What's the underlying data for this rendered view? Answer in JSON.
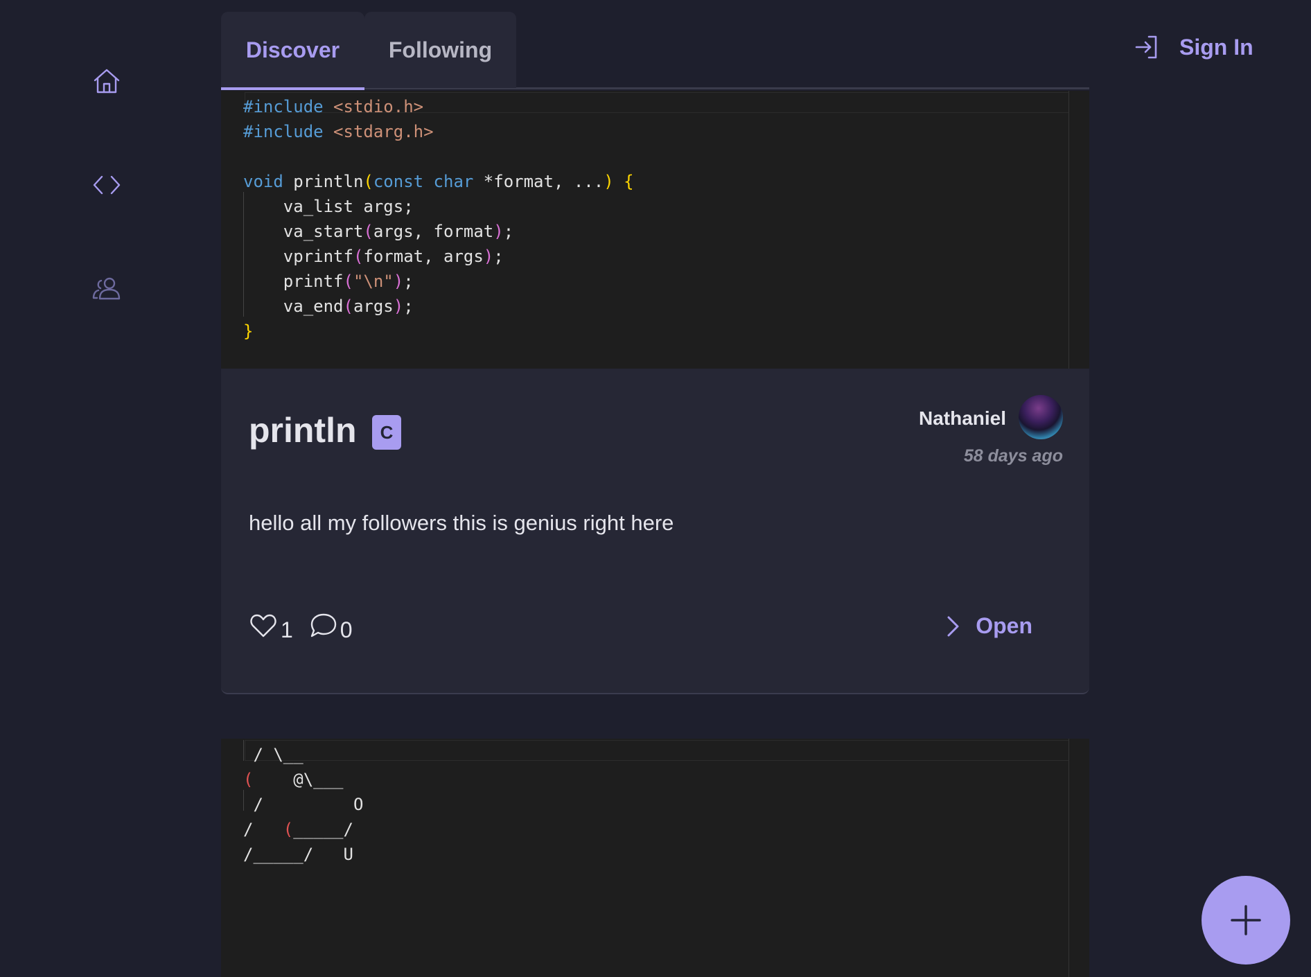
{
  "sidebar": {
    "items": [
      {
        "name": "home",
        "icon": "home-icon"
      },
      {
        "name": "code",
        "icon": "code-icon"
      },
      {
        "name": "users",
        "icon": "users-icon"
      }
    ]
  },
  "tabs": [
    {
      "label": "Discover",
      "active": true
    },
    {
      "label": "Following",
      "active": false
    }
  ],
  "header": {
    "sign_in_label": "Sign In",
    "sign_in_icon": "sign-in-icon"
  },
  "posts": [
    {
      "code_lines": [
        "#include <stdio.h>",
        "#include <stdarg.h>",
        "",
        "void println(const char *format, ...) {",
        "    va_list args;",
        "    va_start(args, format);",
        "    vprintf(format, args);",
        "    printf(\"\\n\");",
        "    va_end(args);",
        "}"
      ],
      "title": "println",
      "language_badge": "C",
      "author": "Nathaniel",
      "time_ago": "58 days ago",
      "description": "hello all my followers this is genius right here",
      "likes": "1",
      "comments": "0",
      "open_label": "Open"
    },
    {
      "code_lines": [
        " / \\__",
        "(    @\\___",
        " /         O",
        "/   (_____/",
        "/_____/   U"
      ]
    }
  ],
  "colors": {
    "background": "#1e1f2d",
    "card": "#262735",
    "accent": "#a89cf0",
    "code_background": "#1e1e1e"
  }
}
